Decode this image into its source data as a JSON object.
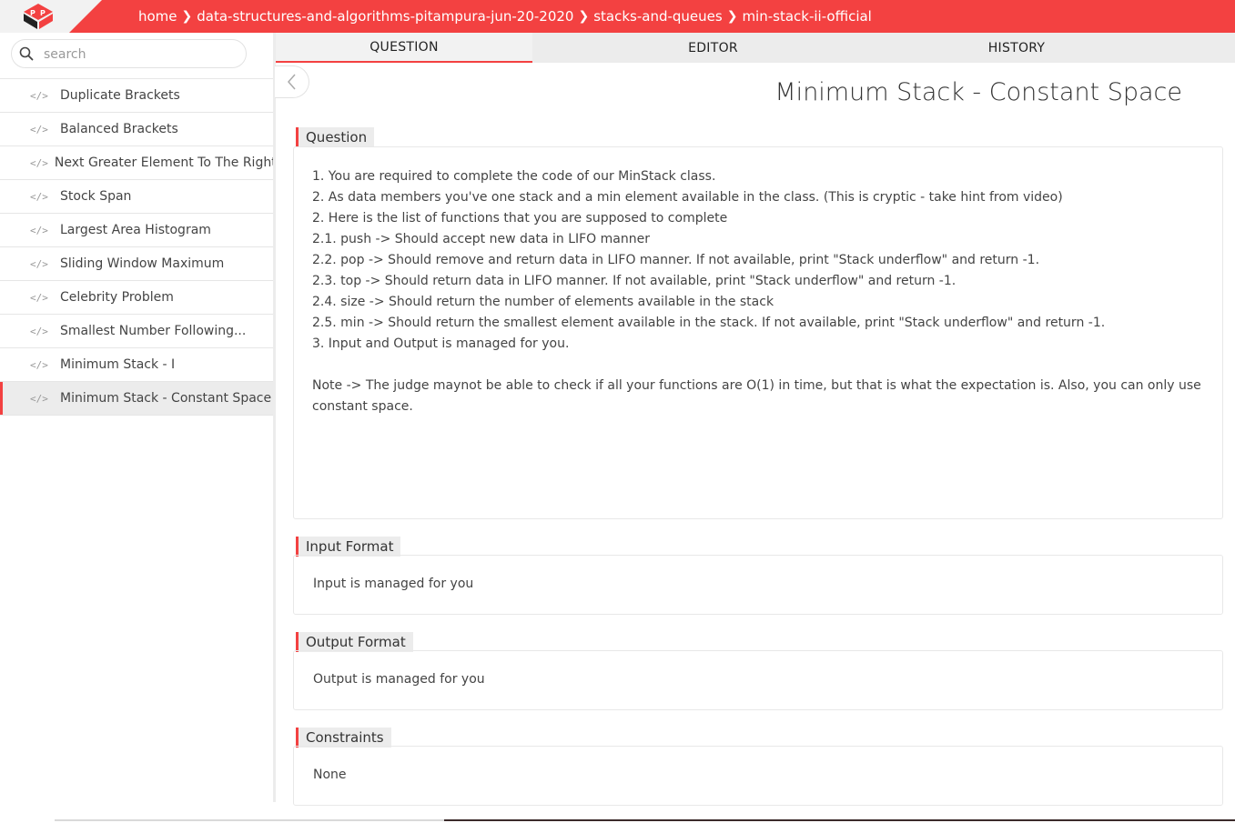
{
  "breadcrumb": [
    "home",
    "data-structures-and-algorithms-pitampura-jun-20-2020",
    "stacks-and-queues",
    "min-stack-ii-official"
  ],
  "search": {
    "placeholder": "search"
  },
  "sidebar": {
    "items": [
      {
        "label": "Duplicate Brackets"
      },
      {
        "label": "Balanced Brackets"
      },
      {
        "label": "Next Greater Element To The Right"
      },
      {
        "label": "Stock Span"
      },
      {
        "label": "Largest Area Histogram"
      },
      {
        "label": "Sliding Window Maximum"
      },
      {
        "label": "Celebrity Problem"
      },
      {
        "label": "Smallest Number Following..."
      },
      {
        "label": "Minimum Stack - I"
      },
      {
        "label": "Minimum Stack - Constant Space"
      }
    ],
    "item_icon": "</>"
  },
  "tabs": [
    "QUESTION",
    "EDITOR",
    "HISTORY"
  ],
  "problem": {
    "title": "Minimum Stack - Constant Space",
    "question_label": "Question",
    "question_lines": [
      "1. You are required to complete the code of our MinStack class.",
      "2. As data members you've one stack and a min element available in the class. (This is cryptic - take hint from video)",
      "2. Here is the list of functions that you are supposed to complete",
      "2.1. push -> Should accept new data in LIFO manner",
      "2.2. pop -> Should remove and return data in LIFO manner. If not available, print \"Stack underflow\" and return -1.",
      "2.3. top -> Should return data in LIFO manner. If not available, print \"Stack underflow\" and return -1.",
      "2.4. size -> Should return the number of elements available in the stack",
      "2.5. min -> Should return the smallest element available in the stack. If not available, print \"Stack underflow\" and return -1.",
      "3. Input and Output is managed for you."
    ],
    "question_note": "Note -> The judge maynot be able to check if all your functions are O(1) in time, but that is what the expectation is. Also, you can only use constant space.",
    "input_label": "Input Format",
    "input_text": "Input is managed for you",
    "output_label": "Output Format",
    "output_text": "Output is managed for you",
    "constraints_label": "Constraints",
    "constraints_text": "None"
  },
  "colors": {
    "accent": "#f34141",
    "tab_bg": "#ececec"
  },
  "icons": [
    "logo-icon",
    "chevron-right-icon",
    "search-icon",
    "code-icon",
    "chevron-left-icon"
  ]
}
